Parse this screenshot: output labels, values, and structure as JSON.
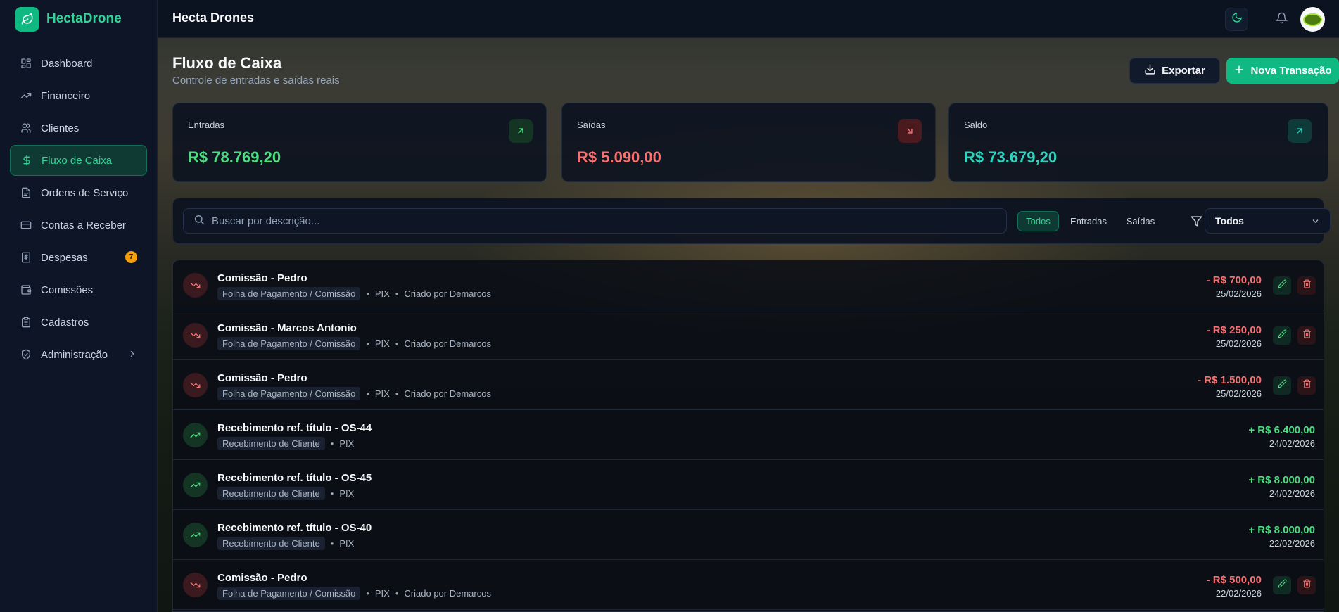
{
  "brand": {
    "name": "HectaDrone",
    "icon": "leaf-icon",
    "accent": "#10b981"
  },
  "sidebar": {
    "items": [
      {
        "label": "Dashboard",
        "icon": "dashboard-icon"
      },
      {
        "label": "Financeiro",
        "icon": "trending-up-icon"
      },
      {
        "label": "Clientes",
        "icon": "users-icon"
      },
      {
        "label": "Fluxo de Caixa",
        "icon": "dollar-icon",
        "active": true
      },
      {
        "label": "Ordens de Serviço",
        "icon": "file-text-icon"
      },
      {
        "label": "Contas a Receber",
        "icon": "credit-card-icon"
      },
      {
        "label": "Despesas",
        "icon": "receipt-icon",
        "badge": "7"
      },
      {
        "label": "Comissões",
        "icon": "wallet-icon"
      },
      {
        "label": "Cadastros",
        "icon": "clipboard-icon"
      },
      {
        "label": "Administração",
        "icon": "shield-icon"
      }
    ]
  },
  "topbar": {
    "title": "Hecta Drones"
  },
  "page": {
    "title": "Fluxo de Caixa",
    "subtitle": "Controle de entradas e saídas reais",
    "export_label": "Exportar",
    "new_label": "Nova Transação"
  },
  "cards": [
    {
      "label": "Entradas",
      "value": "R$ 78.769,20",
      "color": "#4ade80"
    },
    {
      "label": "Saídas",
      "value": "R$ 5.090,00",
      "color": "#f87171"
    },
    {
      "label": "Saldo",
      "value": "R$ 73.679,20",
      "color": "#2dd4bf"
    }
  ],
  "filters": {
    "search_placeholder": "Buscar por descrição...",
    "segments": [
      "Todos",
      "Entradas",
      "Saídas"
    ],
    "select_value": "Todos"
  },
  "transactions": [
    {
      "title": "Comissão - Pedro",
      "category": "Folha de Pagamento / Comissão",
      "method": "PIX",
      "creator": "Criado por Demarcos",
      "amount": "- R$ 700,00",
      "date": "25/02/2026",
      "type": "out"
    },
    {
      "title": "Comissão - Marcos Antonio",
      "category": "Folha de Pagamento / Comissão",
      "method": "PIX",
      "creator": "Criado por Demarcos",
      "amount": "- R$ 250,00",
      "date": "25/02/2026",
      "type": "out"
    },
    {
      "title": "Comissão - Pedro",
      "category": "Folha de Pagamento / Comissão",
      "method": "PIX",
      "creator": "Criado por Demarcos",
      "amount": "- R$ 1.500,00",
      "date": "25/02/2026",
      "type": "out"
    },
    {
      "title": "Recebimento ref. título - OS-44",
      "category": "Recebimento de Cliente",
      "method": "PIX",
      "amount": "+ R$ 6.400,00",
      "date": "24/02/2026",
      "type": "in"
    },
    {
      "title": "Recebimento ref. título - OS-45",
      "category": "Recebimento de Cliente",
      "method": "PIX",
      "amount": "+ R$ 8.000,00",
      "date": "24/02/2026",
      "type": "in"
    },
    {
      "title": "Recebimento ref. título - OS-40",
      "category": "Recebimento de Cliente",
      "method": "PIX",
      "amount": "+ R$ 8.000,00",
      "date": "22/02/2026",
      "type": "in"
    },
    {
      "title": "Comissão - Pedro",
      "category": "Folha de Pagamento / Comissão",
      "method": "PIX",
      "creator": "Criado por Demarcos",
      "amount": "- R$ 500,00",
      "date": "22/02/2026",
      "type": "out"
    }
  ]
}
